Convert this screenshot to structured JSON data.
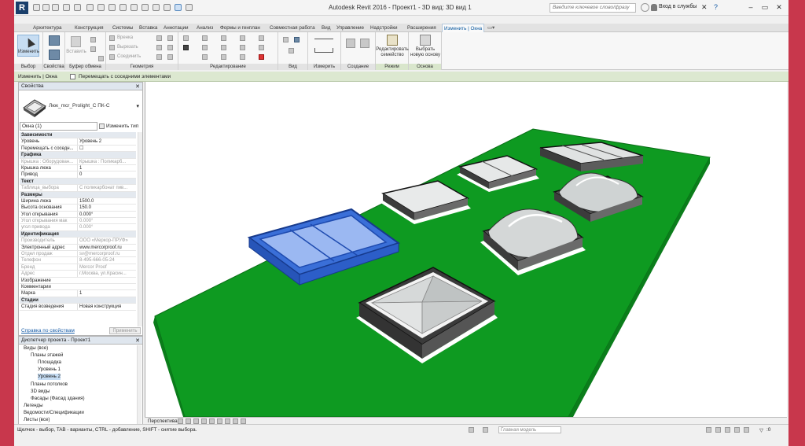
{
  "app": {
    "title": "Autodesk Revit 2016 -",
    "project_view": "Проект1 - 3D вид: 3D вид 1",
    "search_placeholder": "Введите ключевое слово/фразу",
    "sign_in": "Вход в службы"
  },
  "tabs": [
    "Архитектура",
    "Конструкция",
    "Системы",
    "Вставка",
    "Аннотации",
    "Анализ",
    "Формы и генплан",
    "Совместная работа",
    "Вид",
    "Управление",
    "Надстройки",
    "Расширения",
    "Изменить | Окна"
  ],
  "ribbon": {
    "modify_label": "Изменить",
    "insert_label": "Вставить",
    "small": {
      "cut": "Вырезать",
      "paste": "Соединить",
      "copy": "Вренка"
    },
    "edit_family": "Редактировать семейство",
    "pick_host": "Выбрать новую основу",
    "groups": [
      "Выбор",
      "Свойства",
      "Буфер обмена",
      "Геометрия",
      "Редактирование",
      "Вид",
      "Измерить",
      "Создание",
      "Режим",
      "Основа"
    ]
  },
  "context_bar": {
    "label": "Изменить | Окна",
    "checkbox_label": "Перемещать с соседними элементами"
  },
  "properties": {
    "header": "Свойства",
    "type_name": "Люк_mcr_Prolight_C ПК-С",
    "selector": "Окна (1)",
    "edit_type": "Изменить тип",
    "rows": [
      {
        "cat": "Зависимости"
      },
      {
        "name": "Уровень",
        "value": "Уровень 2"
      },
      {
        "name": "Перемещать с соседн...",
        "value": "☐"
      },
      {
        "cat": "Графика"
      },
      {
        "name": "Крышка : Оборудован...",
        "value": "Крышка : Поликарб...",
        "grey": true
      },
      {
        "name": "Крышка люка",
        "value": "1"
      },
      {
        "name": "Привод",
        "value": "0"
      },
      {
        "cat": "Текст"
      },
      {
        "name": "Таблица_выбора",
        "value": "С поликарбонат пив...",
        "grey": true
      },
      {
        "cat": "Размеры"
      },
      {
        "name": "Ширина люка",
        "value": "1500.0"
      },
      {
        "name": "Высота основания",
        "value": "150.0"
      },
      {
        "name": "Угол открывания",
        "value": "0.000°"
      },
      {
        "name": "Угол открывания мак",
        "value": "0.000°",
        "grey": true
      },
      {
        "name": "угол привода",
        "value": "0.000°",
        "grey": true
      },
      {
        "cat": "Идентификация"
      },
      {
        "name": "Производитель",
        "value": "ООО «Меркор-ПРУФ»",
        "grey": true
      },
      {
        "name": "Электронный адрес",
        "value": "www.mercorproof.ru"
      },
      {
        "name": "Отдел продаж",
        "value": "sv@mercorproof.ru",
        "grey": true
      },
      {
        "name": "Телефон",
        "value": "8-495-666-05-24",
        "grey": true
      },
      {
        "name": "Бренд",
        "value": "Mercor Proof",
        "grey": true
      },
      {
        "name": "Адрес",
        "value": "г.Москва, ул.Красин...",
        "grey": true
      },
      {
        "name": "Изображение",
        "value": ""
      },
      {
        "name": "Комментарии",
        "value": ""
      },
      {
        "name": "Марка",
        "value": "1"
      },
      {
        "cat": "Стадии"
      },
      {
        "name": "Стадия возведения",
        "value": "Новая конструкция"
      }
    ],
    "help_link": "Справка по свойствам",
    "apply": "Применить"
  },
  "browser": {
    "header": "Диспетчер проекта - Проект1",
    "items": [
      {
        "label": "Виды (все)",
        "level": 0
      },
      {
        "label": "Планы этажей",
        "level": 1
      },
      {
        "label": "Площадка",
        "level": 2
      },
      {
        "label": "Уровень 1",
        "level": 2
      },
      {
        "label": "Уровень 2",
        "level": 2,
        "selected": true
      },
      {
        "label": "Планы потолков",
        "level": 1
      },
      {
        "label": "3D виды",
        "level": 1
      },
      {
        "label": "Фасады (Фасад здания)",
        "level": 1
      },
      {
        "label": "Легенды",
        "level": 0
      },
      {
        "label": "Ведомости/Спецификации",
        "level": 0
      },
      {
        "label": "Листы (все)",
        "level": 0
      }
    ]
  },
  "view_bar": {
    "label": "Перспектива"
  },
  "status": {
    "text": "Щелчок - выбор, TAB - варианты, CTRL - добавление, SHIFT - снятие выбора.",
    "model": "Главная модель",
    "count": ":0"
  },
  "colors": {
    "ground": "#0e9a21",
    "selection": "#3a6fd8",
    "active_tab": "#0b5aa0",
    "frame": "#c8374c"
  }
}
